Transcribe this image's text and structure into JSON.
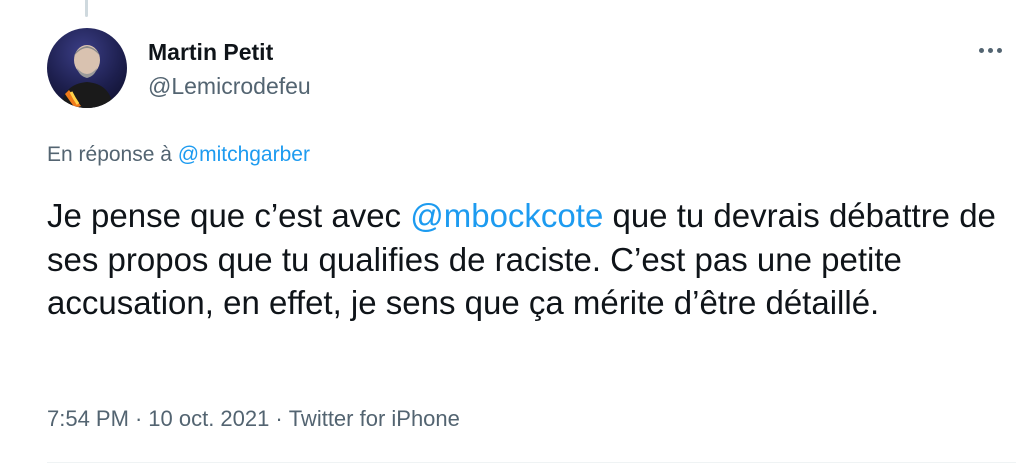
{
  "author": {
    "name": "Martin Petit",
    "handle": "@Lemicrodefeu",
    "avatar_icon": "avatar-photo"
  },
  "reply_context": {
    "prefix": "En réponse à ",
    "mention": "@mitchgarber"
  },
  "tweet": {
    "text_before": "Je pense que c’est avec ",
    "mention": "@mbockcote",
    "text_after": " que tu devrais débattre de ses propos que tu qualifies de raciste. C’est pas une petite accusation, en effet, je sens que ça mérite d’être détaillé."
  },
  "meta": {
    "time": "7:54 PM",
    "separator": "·",
    "date": "10 oct. 2021",
    "source": "Twitter for iPhone"
  },
  "colors": {
    "mention": "#1d9bf0",
    "secondary_text": "#536471",
    "primary_text": "#0f1419"
  }
}
